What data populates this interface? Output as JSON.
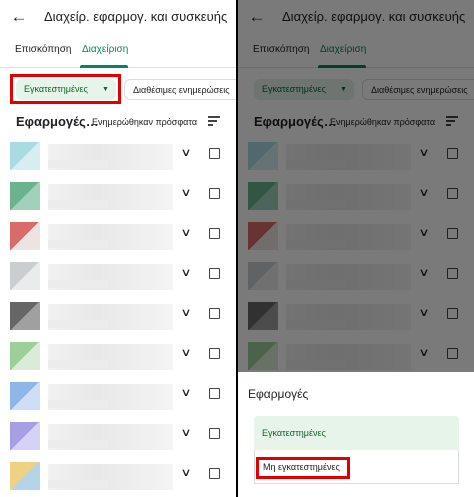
{
  "header": {
    "title": "Διαχείρ. εφαρμογ. και συσκευής",
    "back_icon": "arrow-back-icon"
  },
  "tabs": [
    {
      "label": "Επισκόπηση"
    },
    {
      "label": "Διαχείριση",
      "selected": true
    }
  ],
  "filters": {
    "installed_chip": "Εγκατεστημένες",
    "updates_chip": "Διαθέσιμες ενημερώσεις"
  },
  "list": {
    "title": "Εφαρμογές…",
    "sort_label": "Ενημερώθηκαν πρόσφατα",
    "app_rows": [
      {
        "icon_colors": [
          "#8ecfd8",
          "#c9e8ee"
        ]
      },
      {
        "icon_colors": [
          "#3a9a6a",
          "#7fc2a4"
        ]
      },
      {
        "icon_colors": [
          "#cc3a3a",
          "#e9dada"
        ]
      },
      {
        "icon_colors": [
          "#b9bdbf",
          "#e3e5e6"
        ]
      },
      {
        "icon_colors": [
          "#333333",
          "#808080"
        ]
      },
      {
        "icon_colors": [
          "#7cbf7a",
          "#cfe6c8"
        ]
      },
      {
        "icon_colors": [
          "#6a9de0",
          "#bcd3f3"
        ]
      },
      {
        "icon_colors": [
          "#8a7ee0",
          "#c8c2f4"
        ]
      },
      {
        "icon_colors": [
          "#e8c25a",
          "#9ec6e0"
        ]
      }
    ]
  },
  "sheet": {
    "title": "Εφαρμογές",
    "option_installed": "Εγκατεστημένες",
    "option_not_installed": "Μη εγκατεστημένες"
  },
  "colors": {
    "accent": "#01875f",
    "chip_bg": "#e6f4ea",
    "highlight": "#e00000"
  }
}
